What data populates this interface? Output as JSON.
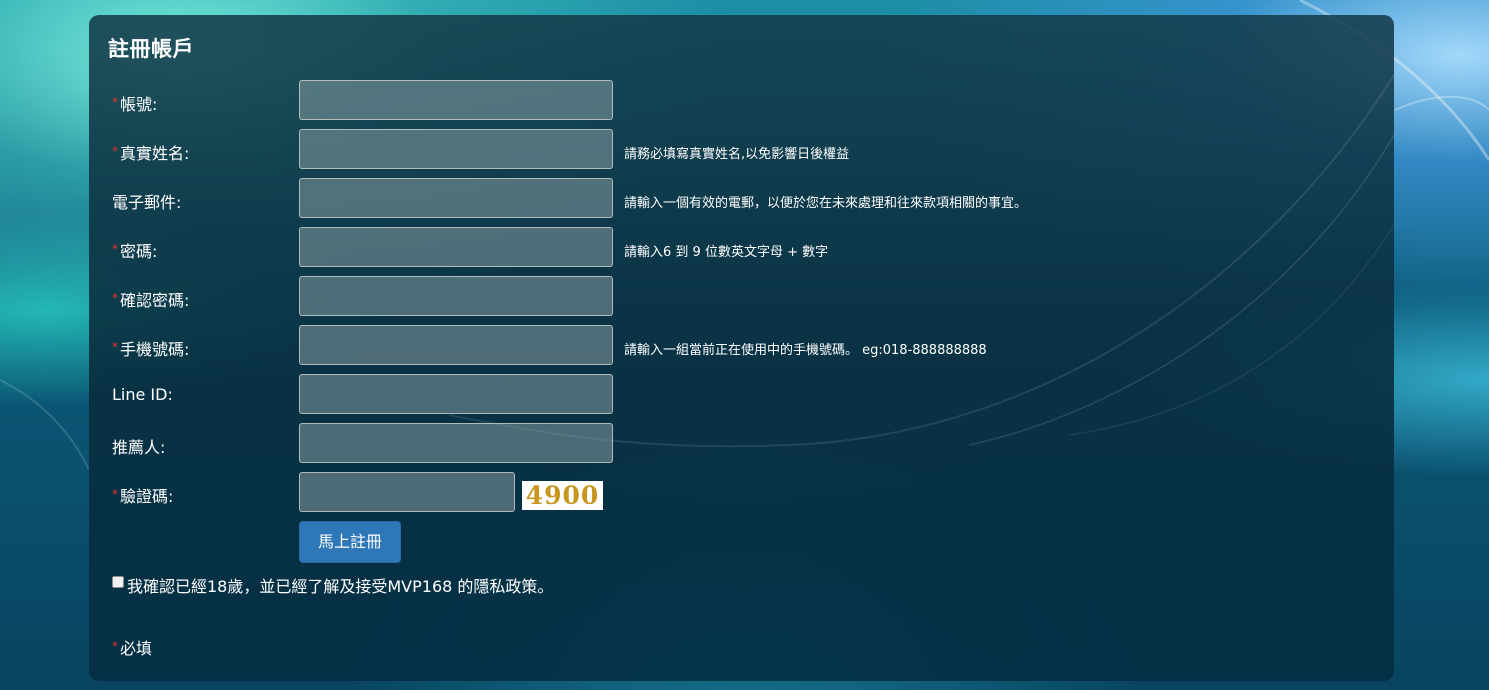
{
  "form": {
    "title": "註冊帳戶",
    "required_mark": "*",
    "fields": [
      {
        "key": "account",
        "label": "帳號:",
        "required": true,
        "value": "",
        "hint": ""
      },
      {
        "key": "realname",
        "label": "真實姓名:",
        "required": true,
        "value": "",
        "hint": "請務必填寫真實姓名,以免影響日後權益"
      },
      {
        "key": "email",
        "label": "電子郵件:",
        "required": false,
        "value": "",
        "hint": "請輸入一個有效的電郵，以便於您在未來處理和往來款項相關的事宜。"
      },
      {
        "key": "password",
        "label": "密碼:",
        "required": true,
        "value": "",
        "hint": "請輸入6 到 9 位數英文字母 + 數字"
      },
      {
        "key": "confirm_password",
        "label": "確認密碼:",
        "required": true,
        "value": "",
        "hint": ""
      },
      {
        "key": "phone",
        "label": "手機號碼:",
        "required": true,
        "value": "",
        "hint": "請輸入一組當前正在使用中的手機號碼。 eg:018-888888888"
      },
      {
        "key": "line_id",
        "label": "Line ID:",
        "required": false,
        "value": "",
        "hint": ""
      },
      {
        "key": "referrer",
        "label": "推薦人:",
        "required": false,
        "value": "",
        "hint": ""
      },
      {
        "key": "captcha",
        "label": "驗證碼:",
        "required": true,
        "value": "",
        "hint": ""
      }
    ],
    "captcha_code": "4900",
    "submit_label": "馬上註冊",
    "agree_text": "我確認已經18歲，並已經了解及接受MVP168 的隱私政策。",
    "agree_checked": false,
    "required_note": "必填"
  },
  "colors": {
    "required_mark": "#e8342c",
    "button": "#2e77b8",
    "captcha_text": "#c8961e"
  }
}
